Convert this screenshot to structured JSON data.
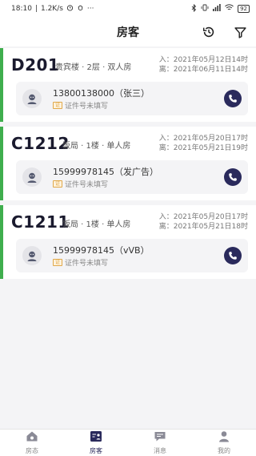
{
  "status_bar": {
    "time": "18:10",
    "speed": "1.2K/s",
    "more": "···",
    "battery": "92"
  },
  "header": {
    "title": "房客"
  },
  "rooms": [
    {
      "number": "D201",
      "location": "贵宾楼 · 2层 · 双人房",
      "checkin": "入：2021年05月12日14时",
      "checkout": "离：2021年06月11日14时",
      "phone": "13800138000（张三）",
      "id_status": "证件号未填写"
    },
    {
      "number": "C1212",
      "location": "饭局 · 1楼 · 单人房",
      "checkin": "入：2021年05月20日17时",
      "checkout": "离：2021年05月21日19时",
      "phone": "15999978145（发广告）",
      "id_status": "证件号未填写"
    },
    {
      "number": "C1211",
      "location": "饭局 · 1楼 · 单人房",
      "checkin": "入：2021年05月20日17时",
      "checkout": "离：2021年05月21日18时",
      "phone": "15999978145（vVB）",
      "id_status": "证件号未填写"
    }
  ],
  "tabs": [
    {
      "label": "房态",
      "icon": "house-icon"
    },
    {
      "label": "房客",
      "icon": "guest-icon"
    },
    {
      "label": "消息",
      "icon": "message-icon"
    },
    {
      "label": "我的",
      "icon": "profile-icon"
    }
  ],
  "active_tab": "房客",
  "colors": {
    "accent": "#2a2a5c",
    "stripe": "#3fae4d",
    "id_badge": "#e0a84a"
  }
}
